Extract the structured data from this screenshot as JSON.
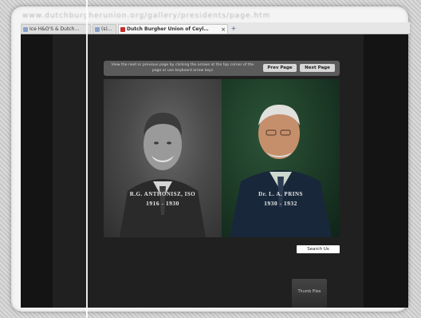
{
  "browser": {
    "url_text": "www.dutchburgherunion.org/gallery/presidents/page.htm",
    "tabs": [
      {
        "label": "Ice H&O'S & Dutch…",
        "active": false
      },
      {
        "label": "(s)…",
        "active": false
      },
      {
        "label": "Dutch Burgher Union of Ceyl…",
        "active": true
      }
    ],
    "new_tab_symbol": "+",
    "close_symbol": "×"
  },
  "page": {
    "notice": "View the next or previous page by clicking the arrows at the top corner of the page or use keyboard arrow keys",
    "prev_label": "Prev Page",
    "next_label": "Next Page",
    "portraits": [
      {
        "name": "R.G. ANTHONISZ, ISO",
        "years": "1916 - 1930"
      },
      {
        "name": "Dr. L. A. PRINS",
        "years": "1930 - 1932"
      }
    ],
    "search_label": "Search Us",
    "thumb_label": "Thumb Files"
  },
  "colors": {
    "viewport_bg": "#141414",
    "content_bg": "#202020",
    "left_portrait_tone": "#4a4a4a",
    "right_portrait_tone": "#1c3a26"
  }
}
